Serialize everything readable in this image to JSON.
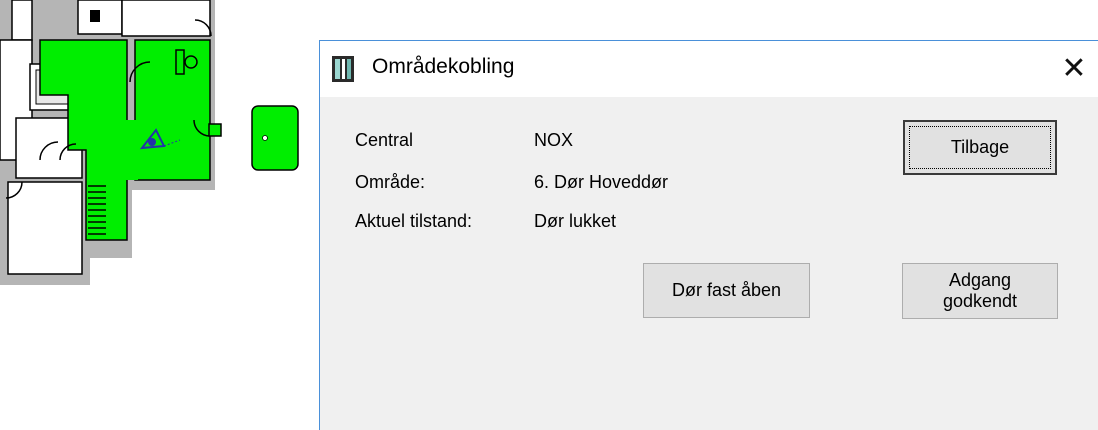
{
  "dialog": {
    "title": "Områdekobling",
    "close_glyph": "✕",
    "fields": [
      {
        "label": "Central",
        "value": "NOX"
      },
      {
        "label": "Område:",
        "value": "6. Dør Hoveddør"
      },
      {
        "label": "Aktuel tilstand:",
        "value": "Dør lukket"
      }
    ],
    "buttons": {
      "back": "Tilbage",
      "door_open": "Dør fast åben",
      "access_line1": "Adgang",
      "access_line2": "godkendt"
    }
  },
  "floorplan": {
    "highlight_color": "#00ee00",
    "icons": [
      "camera-icon",
      "door-icon",
      "toilet-icon"
    ]
  }
}
